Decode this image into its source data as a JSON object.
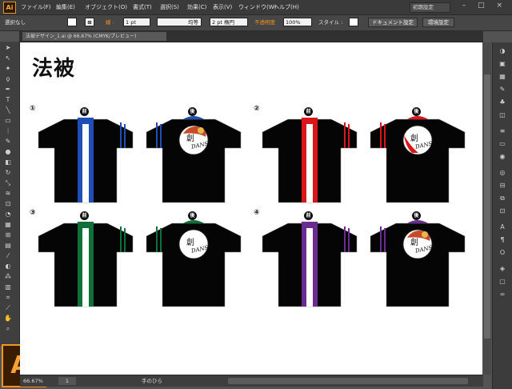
{
  "app": {
    "logo": "Ai"
  },
  "menu": {
    "items": [
      "ファイル(F)",
      "編集(E)",
      "オブジェクト(O)",
      "書式(T)",
      "選択(S)",
      "効果(C)",
      "表示(V)",
      "ウィンドウ(W)",
      "ヘルプ(H)"
    ],
    "workspace": "初期設定",
    "window_controls": "– □ ×"
  },
  "control": {
    "selection": "選択なし",
    "stroke_label": "線 :",
    "stroke_value": "1 pt",
    "profile": "均等",
    "brush": "2 pt 楕円",
    "opacity_label": "不透明度",
    "opacity_value": "100%",
    "style_label": "スタイル :",
    "doc_settings": "ドキュメント設定",
    "prefs": "環境設定"
  },
  "document": {
    "tab": "法被デザイン_1.ai @ 66.67% (CMYK/プレビュー)"
  },
  "page": {
    "title": "法被",
    "labels": {
      "front": "前",
      "back": "後"
    },
    "sets": [
      {
        "number": "①",
        "accent": "#1f4fb4",
        "logo": "flower"
      },
      {
        "number": "②",
        "accent": "#d9161a",
        "logo": "wave"
      },
      {
        "number": "③",
        "accent": "#10703a",
        "logo": "plain"
      },
      {
        "number": "④",
        "accent": "#6a2c91",
        "logo": "flower"
      }
    ],
    "logo_text": {
      "kanji": "創",
      "latin": "DANS"
    }
  },
  "status": {
    "zoom": "66.67%",
    "page": "1",
    "tool": "手のひら"
  },
  "tools": [
    "selection-arrow",
    "direct-selection",
    "magic-wand",
    "lasso",
    "pen",
    "type",
    "line",
    "rectangle",
    "paintbrush",
    "pencil",
    "blob-brush",
    "eraser",
    "rotate",
    "scale",
    "warp",
    "free-transform",
    "shape-builder",
    "perspective-grid",
    "mesh",
    "gradient",
    "eyedropper",
    "blend",
    "symbol-sprayer",
    "column-graph",
    "artboard",
    "slice",
    "hand",
    "zoom"
  ],
  "panels": [
    "color",
    "color-guide",
    "swatches",
    "brushes",
    "symbols",
    "graphic-styles",
    "stroke",
    "gradient",
    "transparency",
    "appearance",
    "align",
    "pathfinder",
    "transform",
    "character",
    "paragraph",
    "opentype",
    "layers",
    "artboards",
    "links"
  ]
}
